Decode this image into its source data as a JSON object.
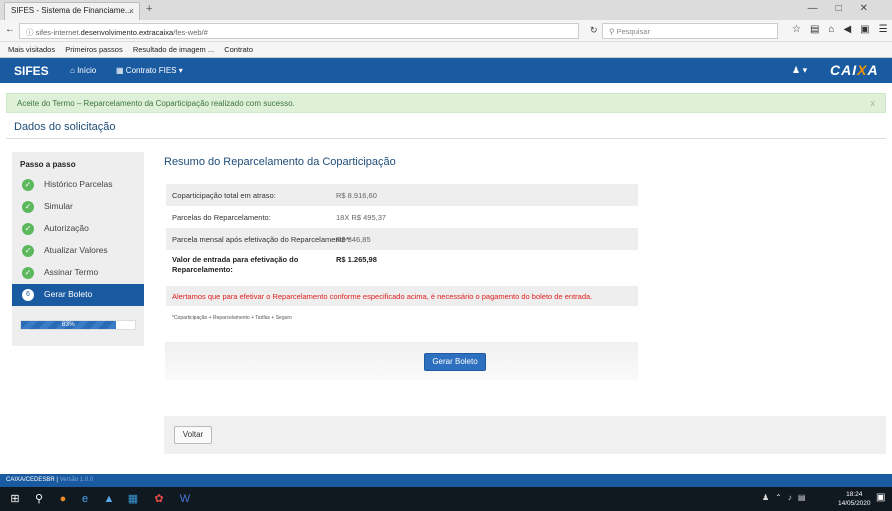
{
  "browser": {
    "tab_title": "SIFES - Sistema de Financiame...",
    "tab_close": "×",
    "new_tab": "+",
    "url_prefix": "sifes-internet.",
    "url_domain": "desenvolvimento.extracaixa",
    "url_suffix": "/fes-web/#",
    "search_placeholder": "Pesquisar",
    "bookmarks": [
      "Mais visitados",
      "Primeiros passos",
      "Resultado de imagem ...",
      "Contrato"
    ]
  },
  "header": {
    "brand": "SIFES",
    "nav_inicio": "Início",
    "nav_contrato": "Contrato FIES ▾",
    "user_menu": "▾",
    "logo_main": "CAI",
    "logo_x": "X",
    "logo_end": "A"
  },
  "alert": {
    "message": "Aceite do Termo – Reparcelamento da Coparticipação realizado com sucesso.",
    "close": "x"
  },
  "section_title": "Dados do solicitação",
  "steps": {
    "title": "Passo a passo",
    "items": [
      {
        "label": "Histórico Parcelas"
      },
      {
        "label": "Simular"
      },
      {
        "label": "Autorização"
      },
      {
        "label": "Atualizar Valores"
      },
      {
        "label": "Assinar Termo"
      },
      {
        "label": "Gerar Boleto",
        "number": "6"
      }
    ],
    "progress_label": "83%",
    "progress_value": 0.83
  },
  "summary": {
    "title": "Resumo do Reparcelamento da Coparticipação",
    "rows": [
      {
        "label": "Coparticipação total em atraso:",
        "value": "R$ 8.916,60"
      },
      {
        "label": "Parcelas do Reparcelamento:",
        "value": "18X R$ 495,37"
      },
      {
        "label": "Parcela mensal após efetivação do Reparcelamento*:",
        "value": "R$ 846,85"
      },
      {
        "label": "Valor de entrada para efetivação do Reparcelamento:",
        "value": "R$ 1.265,98"
      }
    ],
    "warning": "Alertamos que para efetivar o Reparcelamento conforme especificado acima, é necessário o pagamento do boleto de entrada.",
    "footnote": "*Coparticipação + Reparcelamento + Tarifas + Seguro"
  },
  "actions": {
    "gerar_boleto": "Gerar Boleto",
    "voltar": "Voltar"
  },
  "footer": {
    "left": "CAIXA/CEDESBR |",
    "version": "Versão 1.0.0"
  },
  "taskbar": {
    "time": "18:24",
    "date": "14/05/2020"
  },
  "colors": {
    "header_blue": "#1a5aa0",
    "success_bg": "#dff0d8",
    "check_green": "#5cb85c",
    "warning_red": "#e02020",
    "caixa_orange": "#f39200"
  }
}
